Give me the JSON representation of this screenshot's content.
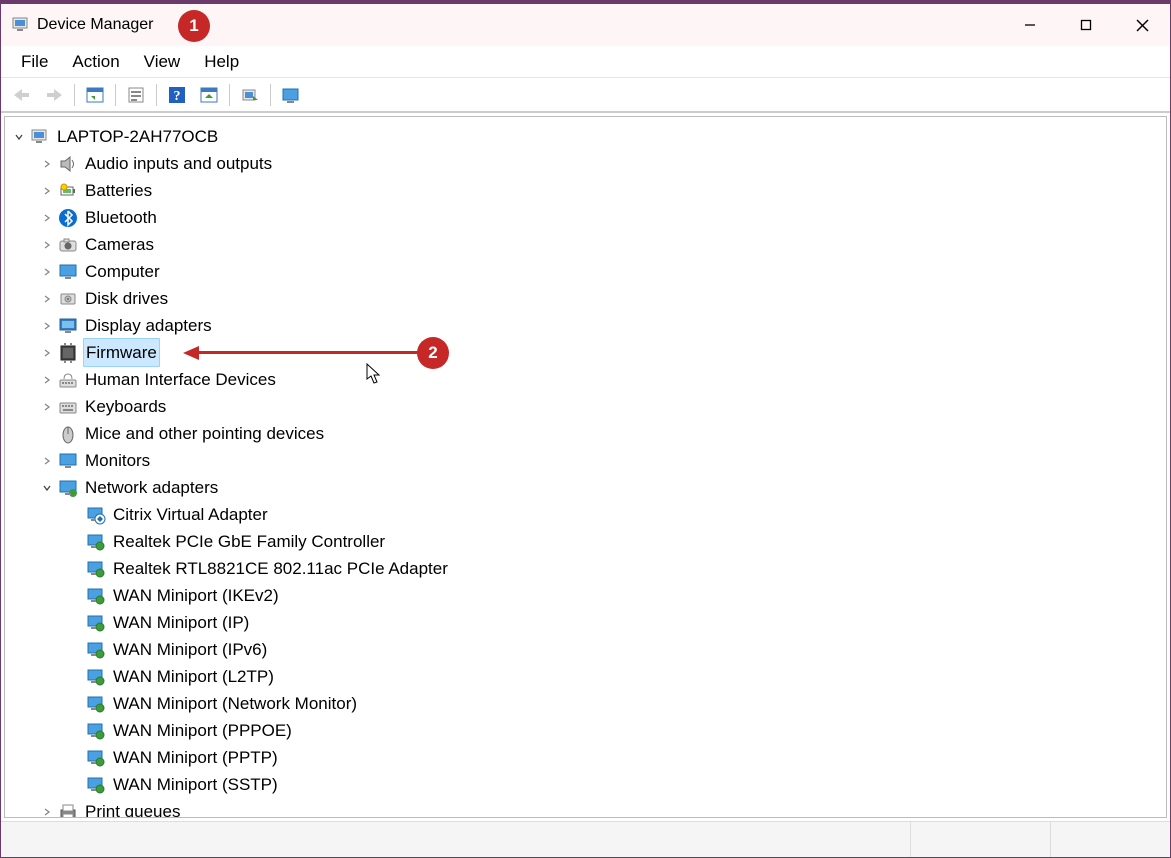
{
  "window": {
    "title": "Device Manager"
  },
  "menus": {
    "file": "File",
    "action": "Action",
    "view": "View",
    "help": "Help"
  },
  "toolbar": {
    "back": "back",
    "forward": "forward",
    "show_hide": "show-hide",
    "properties": "properties",
    "help": "help",
    "action_center": "action-center",
    "scan": "scan",
    "remote": "remote"
  },
  "annotations": {
    "badge1": "1",
    "badge2": "2"
  },
  "tree": {
    "root": {
      "label": "LAPTOP-2AH77OCB",
      "expanded": true,
      "icon": "computer-icon"
    },
    "categories": [
      {
        "label": "Audio inputs and outputs",
        "icon": "speaker-icon",
        "expanded": false,
        "selected": false
      },
      {
        "label": "Batteries",
        "icon": "battery-icon",
        "expanded": false,
        "selected": false
      },
      {
        "label": "Bluetooth",
        "icon": "bluetooth-icon",
        "expanded": false,
        "selected": false
      },
      {
        "label": "Cameras",
        "icon": "camera-icon",
        "expanded": false,
        "selected": false
      },
      {
        "label": "Computer",
        "icon": "monitor-icon",
        "expanded": false,
        "selected": false
      },
      {
        "label": "Disk drives",
        "icon": "disk-icon",
        "expanded": false,
        "selected": false
      },
      {
        "label": "Display adapters",
        "icon": "display-icon",
        "expanded": false,
        "selected": false
      },
      {
        "label": "Firmware",
        "icon": "firmware-icon",
        "expanded": false,
        "selected": true
      },
      {
        "label": "Human Interface Devices",
        "icon": "hid-icon",
        "expanded": false,
        "selected": false
      },
      {
        "label": "Keyboards",
        "icon": "keyboard-icon",
        "expanded": false,
        "selected": false
      },
      {
        "label": "Mice and other pointing devices",
        "icon": "mouse-icon",
        "expanded": false,
        "selected": false,
        "no_expander": true
      },
      {
        "label": "Monitors",
        "icon": "monitor-icon",
        "expanded": false,
        "selected": false
      },
      {
        "label": "Network adapters",
        "icon": "network-icon",
        "expanded": true,
        "selected": false,
        "children": [
          {
            "label": "Citrix Virtual Adapter",
            "icon": "adapter-overlay-icon"
          },
          {
            "label": "Realtek PCIe GbE Family Controller",
            "icon": "adapter-icon"
          },
          {
            "label": "Realtek RTL8821CE 802.11ac PCIe Adapter",
            "icon": "adapter-icon"
          },
          {
            "label": "WAN Miniport (IKEv2)",
            "icon": "adapter-icon"
          },
          {
            "label": "WAN Miniport (IP)",
            "icon": "adapter-icon"
          },
          {
            "label": "WAN Miniport (IPv6)",
            "icon": "adapter-icon"
          },
          {
            "label": "WAN Miniport (L2TP)",
            "icon": "adapter-icon"
          },
          {
            "label": "WAN Miniport (Network Monitor)",
            "icon": "adapter-icon"
          },
          {
            "label": "WAN Miniport (PPPOE)",
            "icon": "adapter-icon"
          },
          {
            "label": "WAN Miniport (PPTP)",
            "icon": "adapter-icon"
          },
          {
            "label": "WAN Miniport (SSTP)",
            "icon": "adapter-icon"
          }
        ]
      },
      {
        "label": "Print queues",
        "icon": "printer-icon",
        "expanded": false,
        "selected": false
      }
    ]
  }
}
